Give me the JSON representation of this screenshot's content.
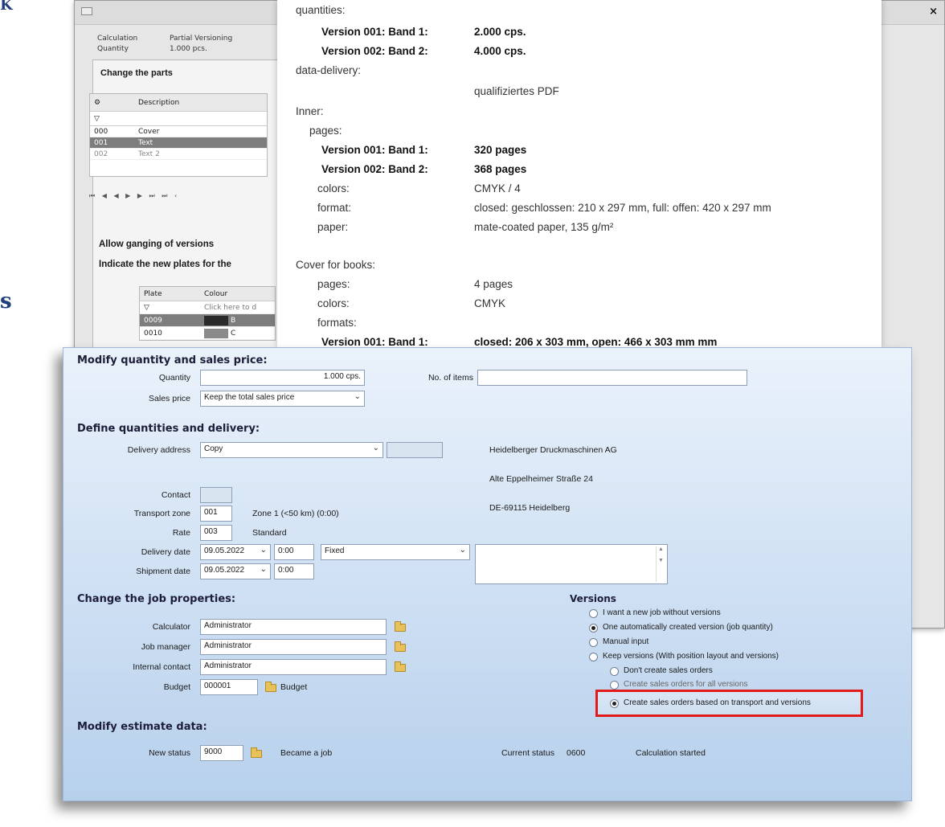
{
  "edge_glyphs": [
    "Κ",
    "s"
  ],
  "back_window": {
    "tabs": [
      "Calculation",
      "Partial Versioning"
    ],
    "quantity_label": "Quantity",
    "quantity_value": "1.000 pcs.",
    "change_parts_title": "Change the parts",
    "parts_header": "Description",
    "parts_rows": [
      {
        "id": "000",
        "desc": "Cover"
      },
      {
        "id": "001",
        "desc": "Text"
      },
      {
        "id": "002",
        "desc": "Text 2"
      }
    ],
    "allow_ganging": "Allow ganging of versions",
    "indicate_plates": "Indicate the new plates for the",
    "plate_headers": [
      "Plate",
      "Colour"
    ],
    "plate_filter_hint": "Click here to d",
    "plate_rows": [
      {
        "plate": "0009",
        "colour": "B"
      },
      {
        "plate": "0010",
        "colour": "C"
      }
    ],
    "colors": {
      "swatch_dark": "#2a2a2a",
      "swatch_grey": "#8a8a8a"
    }
  },
  "info_panel": {
    "quantities_label": "quantities:",
    "q1_label": "Version 001: Band 1:",
    "q1_value": "2.000 cps.",
    "q2_label": "Version 002: Band 2:",
    "q2_value": "4.000 cps.",
    "data_delivery_label": "data-delivery:",
    "data_delivery_value": "qualifiziertes PDF",
    "inner_label": "Inner:",
    "pages_label": "pages:",
    "p1_label": "Version 001: Band 1:",
    "p1_value": "320 pages",
    "p2_label": "Version 002: Band 2:",
    "p2_value": "368 pages",
    "colors_label": "colors:",
    "colors_value": "CMYK / 4",
    "format_label": "format:",
    "format_value": "closed: geschlossen: 210 x 297 mm, full: offen: 420 x 297 mm",
    "paper_label": "paper:",
    "paper_value": "mate-coated paper, 135 g/m²",
    "cover_label": "Cover for books:",
    "cover_pages_label": "pages:",
    "cover_pages_value": "4 pages",
    "cover_colors_label": "colors:",
    "cover_colors_value": "CMYK",
    "cover_formats_label": "formats:",
    "cf1_label": "Version 001: Band 1:",
    "cf1_value": "closed: 206 x 303 mm, open: 466 x 303 mm mm"
  },
  "dialog": {
    "modify_qty_title": "Modify quantity and sales price:",
    "quantity_label": "Quantity",
    "quantity_value": "1.000 cps.",
    "no_items_label": "No. of items",
    "no_items_value": "",
    "sales_price_label": "Sales price",
    "sales_price_value": "Keep the total sales price",
    "define_title": "Define quantities and delivery:",
    "delivery_address_label": "Delivery address",
    "delivery_address_value": "Copy",
    "address_lines": [
      "Heidelberger Druckmaschinen AG",
      "Alte Eppelheimer Straße 24",
      "DE-69115 Heidelberg"
    ],
    "contact_label": "Contact",
    "transport_zone_label": "Transport zone",
    "transport_zone_value": "001",
    "transport_zone_desc": "Zone 1 (<50 km) (0:00)",
    "rate_label": "Rate",
    "rate_value": "003",
    "rate_desc": "Standard",
    "delivery_date_label": "Delivery date",
    "delivery_date_value": "09.05.2022",
    "delivery_time_value": "0:00",
    "fixed_value": "Fixed",
    "shipment_date_label": "Shipment date",
    "shipment_date_value": "09.05.2022",
    "shipment_time_value": "0:00",
    "job_props_title": "Change the job properties:",
    "calculator_label": "Calculator",
    "calculator_value": "Administrator",
    "job_manager_label": "Job manager",
    "job_manager_value": "Administrator",
    "internal_contact_label": "Internal contact",
    "internal_contact_value": "Administrator",
    "budget_label": "Budget",
    "budget_value": "000001",
    "budget_link": "Budget",
    "versions_title": "Versions",
    "versions_options": [
      "I want a new job without versions",
      "One automatically created version (job quantity)",
      "Manual input",
      "Keep versions (With position layout and versions)"
    ],
    "sales_orders_options": [
      "Don't create sales orders",
      "Create sales orders for all versions",
      "Create sales orders based on transport and versions"
    ],
    "modify_estimate_title": "Modify estimate data:",
    "new_status_label": "New status",
    "new_status_value": "9000",
    "new_status_desc": "Became a job",
    "current_status_label": "Current status",
    "current_status_value": "0600",
    "current_status_desc": "Calculation started",
    "colors": {
      "highlight": "#e21a1a",
      "dialog_top": "#eaf2fb",
      "dialog_bottom": "#b7d0ec"
    }
  }
}
